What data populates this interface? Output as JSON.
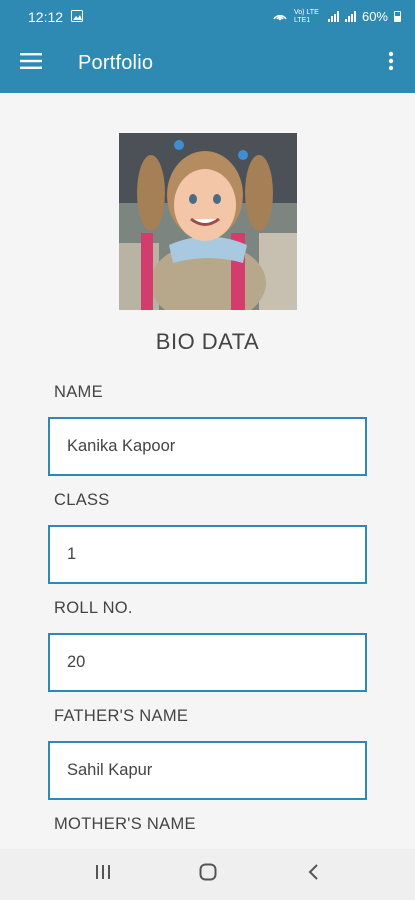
{
  "status_bar": {
    "time": "12:12",
    "network": "Vo) LTE LTE1",
    "battery": "60%"
  },
  "app_bar": {
    "title": "Portfolio",
    "menu_icon": "hamburger-menu-icon",
    "more_icon": "more-vertical-icon"
  },
  "bio": {
    "section_title": "BIO DATA",
    "fields": [
      {
        "label": "NAME",
        "value": "Kanika Kapoor"
      },
      {
        "label": "CLASS",
        "value": "1"
      },
      {
        "label": "ROLL NO.",
        "value": "20"
      },
      {
        "label": "FATHER'S NAME",
        "value": "Sahil Kapur"
      },
      {
        "label": "MOTHER'S NAME",
        "value": ""
      }
    ]
  },
  "nav_bar": {
    "recents_icon": "recents-icon",
    "home_icon": "home-icon",
    "back_icon": "back-icon"
  },
  "colors": {
    "primary": "#2f8ab3",
    "background": "#f5f5f5"
  }
}
